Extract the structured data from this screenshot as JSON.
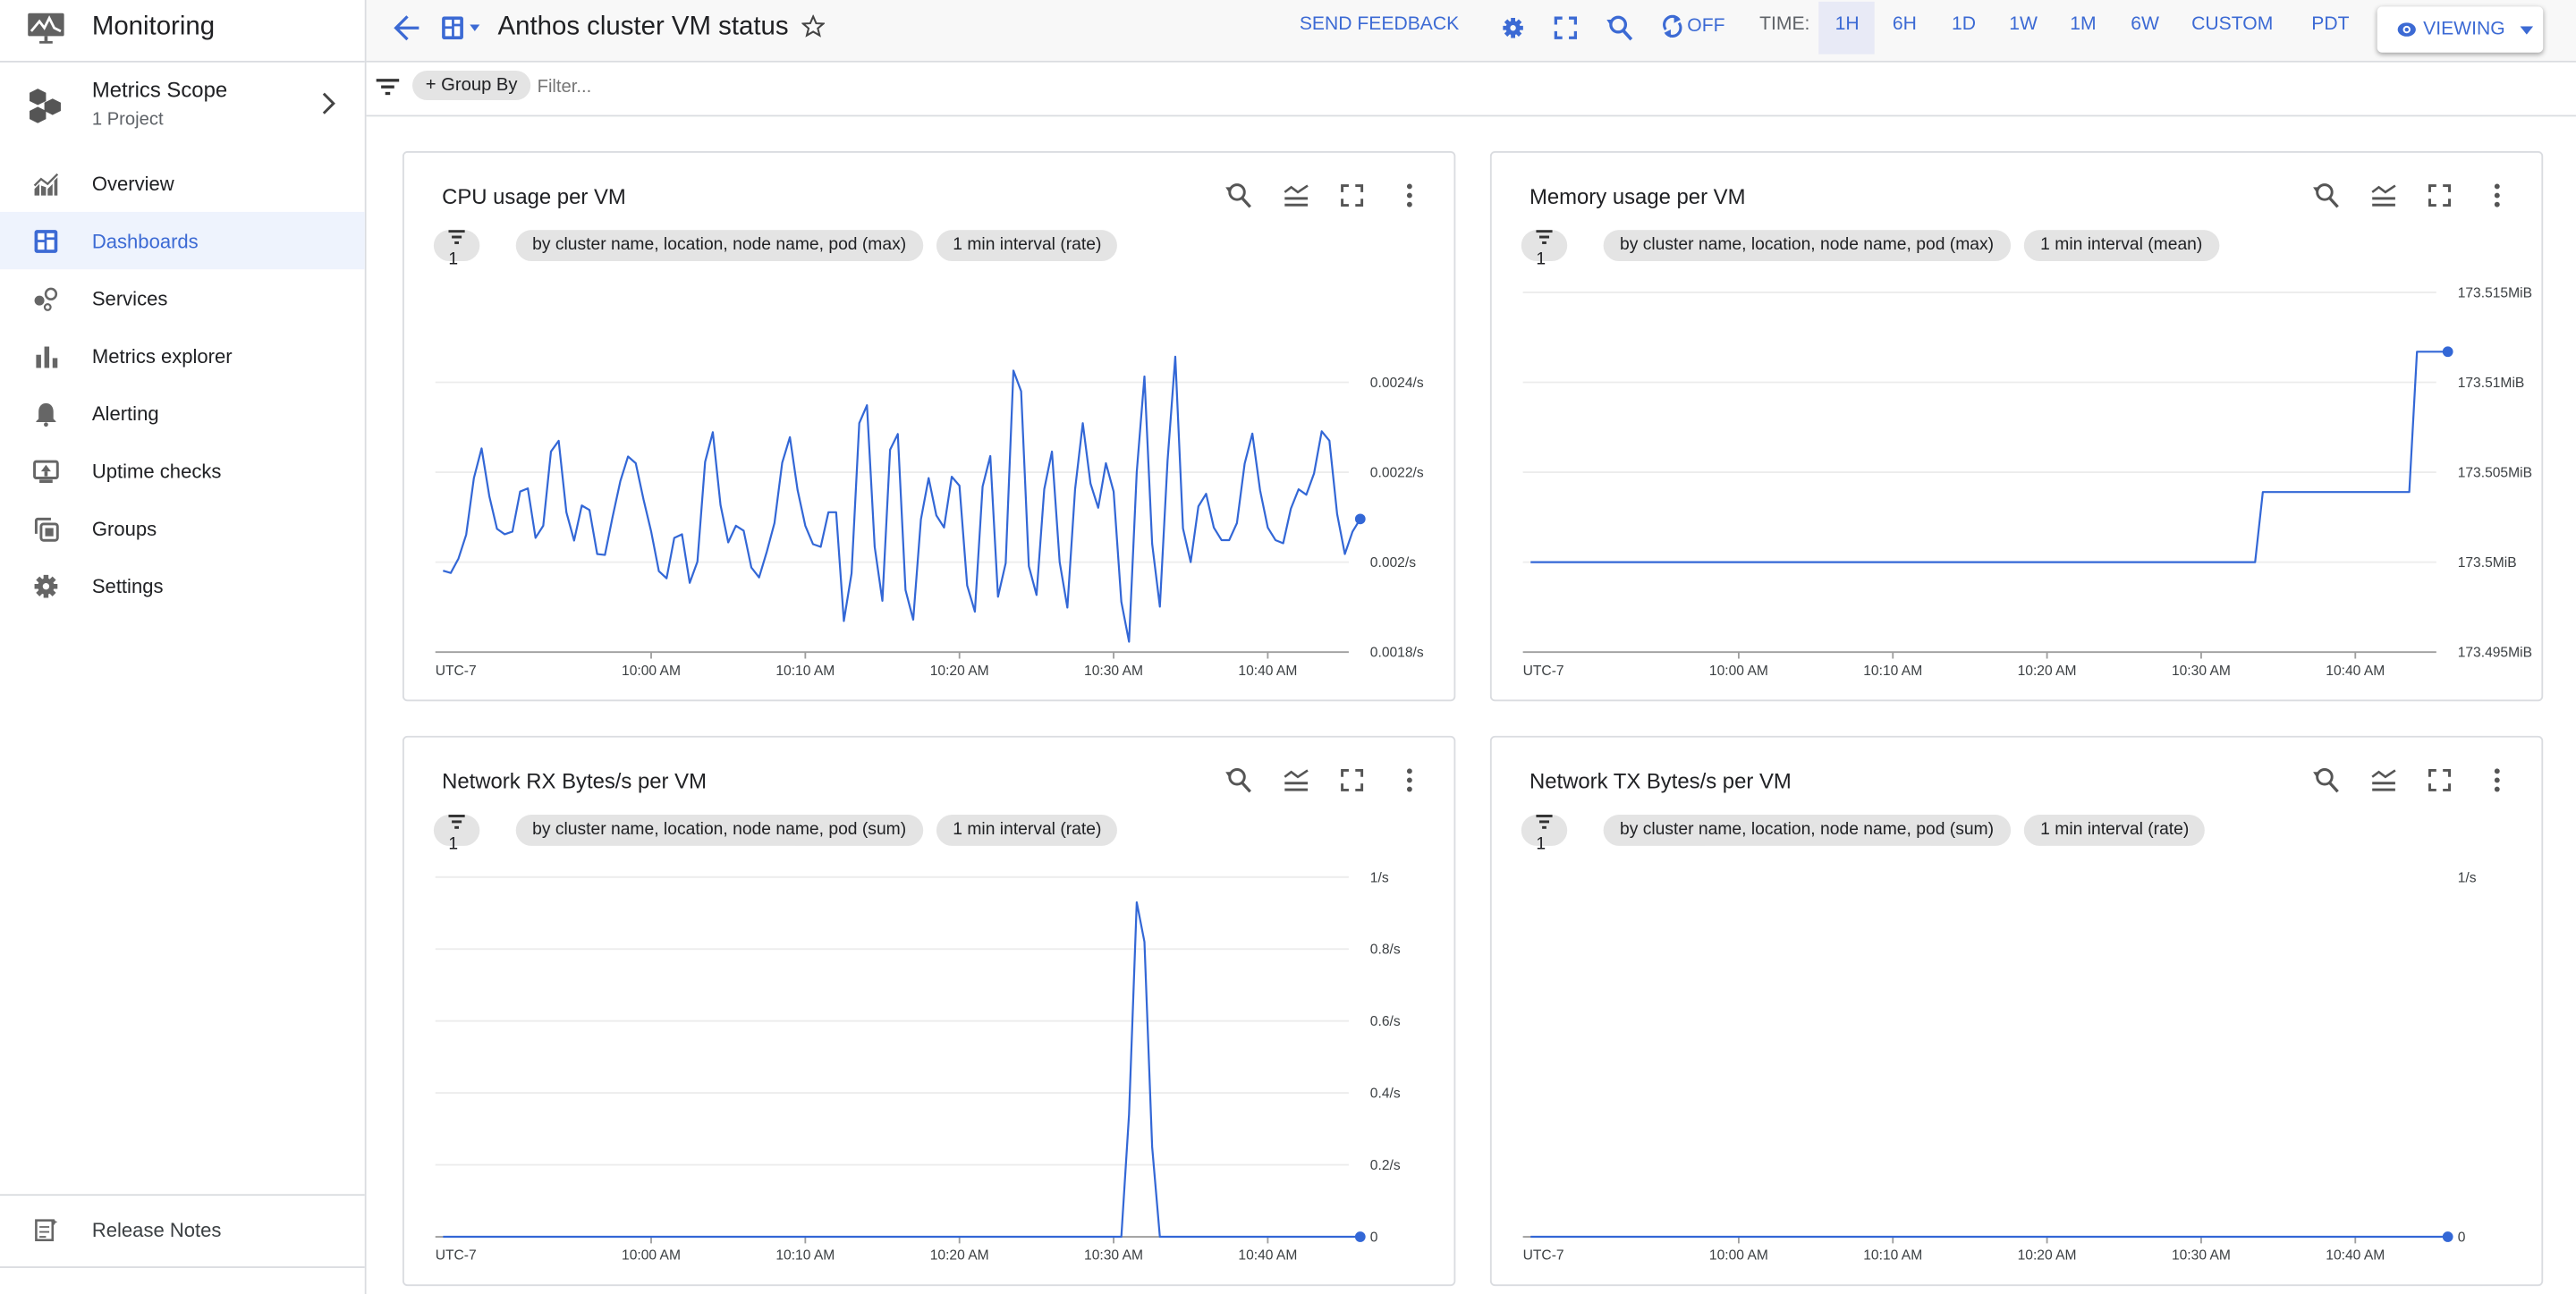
{
  "app": {
    "title": "Monitoring"
  },
  "scope": {
    "title": "Metrics Scope",
    "subtitle": "1 Project"
  },
  "sidebar": {
    "items": [
      {
        "label": "Overview",
        "icon": "overview-chart-icon"
      },
      {
        "label": "Dashboards",
        "icon": "dashboard-icon",
        "active": true
      },
      {
        "label": "Services",
        "icon": "services-icon"
      },
      {
        "label": "Metrics explorer",
        "icon": "bar-chart-icon"
      },
      {
        "label": "Alerting",
        "icon": "bell-icon"
      },
      {
        "label": "Uptime checks",
        "icon": "monitor-icon"
      },
      {
        "label": "Groups",
        "icon": "groups-icon"
      },
      {
        "label": "Settings",
        "icon": "gear-icon"
      }
    ],
    "release_notes": "Release Notes"
  },
  "header": {
    "title": "Anthos cluster VM status",
    "send_feedback": "SEND FEEDBACK",
    "refresh_state": "OFF",
    "time_label": "TIME:",
    "time_ranges": [
      "1H",
      "6H",
      "1D",
      "1W",
      "1M",
      "6W",
      "CUSTOM"
    ],
    "selected_range": "1H",
    "timezone": "PDT",
    "mode": "VIEWING"
  },
  "filterbar": {
    "group_by": "Group By",
    "filter_placeholder": "Filter..."
  },
  "colors": {
    "accent": "#3c6ad4",
    "series": "#3367d6",
    "active_bg": "#eef3fd"
  },
  "cards": [
    {
      "title": "CPU usage per VM",
      "filter_count": "1",
      "aggregation": "by cluster name, location, node name, pod (max)",
      "interval": "1 min interval (rate)"
    },
    {
      "title": "Memory usage per VM",
      "filter_count": "1",
      "aggregation": "by cluster name, location, node name, pod (max)",
      "interval": "1 min interval (mean)"
    },
    {
      "title": "Network RX Bytes/s per VM",
      "filter_count": "1",
      "aggregation": "by cluster name, location, node name, pod (sum)",
      "interval": "1 min interval (rate)"
    },
    {
      "title": "Network TX Bytes/s per VM",
      "filter_count": "1",
      "aggregation": "by cluster name, location, node name, pod (sum)",
      "interval": "1 min interval (rate)"
    }
  ],
  "chart_data": [
    {
      "type": "line",
      "xlim": [
        "9:46:00",
        "10:46:00"
      ],
      "ylim": [
        0.0018,
        0.0026
      ],
      "grid": true,
      "timezone_label": "UTC-7",
      "xticks": [
        {
          "time": "10:00:00",
          "label": "10:00 AM"
        },
        {
          "time": "10:10:00",
          "label": "10:10 AM"
        },
        {
          "time": "10:20:00",
          "label": "10:20 AM"
        },
        {
          "time": "10:30:00",
          "label": "10:30 AM"
        },
        {
          "time": "10:40:00",
          "label": "10:40 AM"
        }
      ],
      "yticks": [
        {
          "value": 0.0018,
          "label": "0.0018/s"
        },
        {
          "value": 0.002,
          "label": "0.002/s"
        },
        {
          "value": 0.0022,
          "label": "0.0022/s"
        },
        {
          "value": 0.0024,
          "label": "0.0024/s"
        }
      ],
      "x": [
        "9:46:30",
        "9:47:00",
        "9:47:30",
        "9:48:00",
        "9:48:30",
        "9:49:00",
        "9:49:30",
        "9:50:00",
        "9:50:30",
        "9:51:00",
        "9:51:30",
        "9:52:00",
        "9:52:30",
        "9:53:00",
        "9:53:30",
        "9:54:00",
        "9:54:30",
        "9:55:00",
        "9:55:30",
        "9:56:00",
        "9:56:30",
        "9:57:00",
        "9:57:30",
        "9:58:00",
        "9:58:30",
        "9:59:00",
        "9:59:30",
        "10:00:00",
        "10:00:30",
        "10:01:00",
        "10:01:30",
        "10:02:00",
        "10:02:30",
        "10:03:00",
        "10:03:30",
        "10:04:00",
        "10:04:30",
        "10:05:00",
        "10:05:30",
        "10:06:00",
        "10:06:30",
        "10:07:00",
        "10:07:30",
        "10:08:00",
        "10:08:30",
        "10:09:00",
        "10:09:30",
        "10:10:00",
        "10:10:30",
        "10:11:00",
        "10:11:30",
        "10:12:00",
        "10:12:30",
        "10:13:00",
        "10:13:30",
        "10:14:00",
        "10:14:30",
        "10:15:00",
        "10:15:30",
        "10:16:00",
        "10:16:30",
        "10:17:00",
        "10:17:30",
        "10:18:00",
        "10:18:30",
        "10:19:00",
        "10:19:30",
        "10:20:00",
        "10:20:30",
        "10:21:00",
        "10:21:30",
        "10:22:00",
        "10:22:30",
        "10:23:00",
        "10:23:30",
        "10:24:00",
        "10:24:30",
        "10:25:00",
        "10:25:30",
        "10:26:00",
        "10:26:30",
        "10:27:00",
        "10:27:30",
        "10:28:00",
        "10:28:30",
        "10:29:00",
        "10:29:30",
        "10:30:00",
        "10:30:30",
        "10:31:00",
        "10:31:30",
        "10:32:00",
        "10:32:30",
        "10:33:00",
        "10:33:30",
        "10:34:00",
        "10:34:30",
        "10:35:00",
        "10:35:30",
        "10:36:00",
        "10:36:30",
        "10:37:00",
        "10:37:30",
        "10:38:00",
        "10:38:30",
        "10:39:00",
        "10:39:30",
        "10:40:00",
        "10:40:30",
        "10:41:00",
        "10:41:30",
        "10:42:00",
        "10:42:30",
        "10:43:00",
        "10:43:30",
        "10:44:00",
        "10:44:30",
        "10:45:00",
        "10:45:30",
        "10:46:00"
      ],
      "series": [
        {
          "values": [
            0.001981,
            0.001976,
            0.002008,
            0.002061,
            0.002187,
            0.002253,
            0.002147,
            0.002074,
            0.002062,
            0.002068,
            0.002157,
            0.002164,
            0.002054,
            0.002081,
            0.002246,
            0.00227,
            0.002111,
            0.002048,
            0.002126,
            0.002116,
            0.002018,
            0.002016,
            0.002101,
            0.00218,
            0.002235,
            0.00222,
            0.00214,
            0.002068,
            0.00198,
            0.001964,
            0.002054,
            0.002062,
            0.001954,
            0.002001,
            0.002223,
            0.002289,
            0.002127,
            0.002044,
            0.002081,
            0.00207,
            0.001988,
            0.001966,
            0.002023,
            0.002087,
            0.002221,
            0.002278,
            0.00216,
            0.002081,
            0.00204,
            0.002034,
            0.002111,
            0.002111,
            0.001869,
            0.001975,
            0.002309,
            0.002349,
            0.002034,
            0.001914,
            0.00225,
            0.002285,
            0.001938,
            0.001872,
            0.002095,
            0.002187,
            0.002104,
            0.002077,
            0.00219,
            0.00217,
            0.001948,
            0.00189,
            0.002168,
            0.002236,
            0.001923,
            0.001998,
            0.002426,
            0.00238,
            0.001991,
            0.001927,
            0.002162,
            0.002246,
            0.002,
            0.001899,
            0.002162,
            0.002309,
            0.002175,
            0.002121,
            0.00222,
            0.002157,
            0.001912,
            0.001823,
            0.0022,
            0.002413,
            0.002041,
            0.001901,
            0.002226,
            0.002457,
            0.002075,
            0.002,
            0.002124,
            0.002152,
            0.002077,
            0.002049,
            0.002049,
            0.002087,
            0.002219,
            0.002286,
            0.00216,
            0.002077,
            0.002049,
            0.002042,
            0.002119,
            0.002162,
            0.00215,
            0.002197,
            0.002291,
            0.00227,
            0.002107,
            0.002018,
            0.002068,
            0.002096
          ]
        }
      ]
    },
    {
      "type": "line",
      "xlim": [
        "9:46:00",
        "10:46:00"
      ],
      "ylim": [
        173.495,
        173.515
      ],
      "grid": true,
      "timezone_label": "UTC-7",
      "xticks": [
        {
          "time": "10:00:00",
          "label": "10:00 AM"
        },
        {
          "time": "10:10:00",
          "label": "10:10 AM"
        },
        {
          "time": "10:20:00",
          "label": "10:20 AM"
        },
        {
          "time": "10:30:00",
          "label": "10:30 AM"
        },
        {
          "time": "10:40:00",
          "label": "10:40 AM"
        }
      ],
      "yticks": [
        {
          "value": 173.495,
          "label": "173.495MiB"
        },
        {
          "value": 173.5,
          "label": "173.5MiB"
        },
        {
          "value": 173.505,
          "label": "173.505MiB"
        },
        {
          "value": 173.51,
          "label": "173.51MiB"
        },
        {
          "value": 173.515,
          "label": "173.515MiB"
        }
      ],
      "x": [
        "9:46:30",
        "10:33:30",
        "10:34:00",
        "10:43:30",
        "10:44:00",
        "10:46:00"
      ],
      "series": [
        {
          "values": [
            173.5,
            173.5,
            173.5039,
            173.5039,
            173.5117,
            173.5117
          ]
        }
      ]
    },
    {
      "type": "line",
      "xlim": [
        "9:46:00",
        "10:46:00"
      ],
      "ylim": [
        0,
        1
      ],
      "grid": true,
      "timezone_label": "UTC-7",
      "xticks": [
        {
          "time": "10:00:00",
          "label": "10:00 AM"
        },
        {
          "time": "10:10:00",
          "label": "10:10 AM"
        },
        {
          "time": "10:20:00",
          "label": "10:20 AM"
        },
        {
          "time": "10:30:00",
          "label": "10:30 AM"
        },
        {
          "time": "10:40:00",
          "label": "10:40 AM"
        }
      ],
      "yticks": [
        {
          "value": 0,
          "label": "0"
        },
        {
          "value": 0.2,
          "label": "0.2/s"
        },
        {
          "value": 0.4,
          "label": "0.4/s"
        },
        {
          "value": 0.6,
          "label": "0.6/s"
        },
        {
          "value": 0.8,
          "label": "0.8/s"
        },
        {
          "value": 1,
          "label": "1/s"
        }
      ],
      "x": [
        "9:46:30",
        "10:30:30",
        "10:31:00",
        "10:31:30",
        "10:32:00",
        "10:32:30",
        "10:33:00",
        "10:46:00"
      ],
      "series": [
        {
          "values": [
            0,
            0,
            0.34,
            0.93,
            0.82,
            0.25,
            0,
            0
          ]
        }
      ]
    },
    {
      "type": "line",
      "xlim": [
        "9:46:00",
        "10:46:00"
      ],
      "ylim": [
        0,
        1
      ],
      "grid": false,
      "timezone_label": "UTC-7",
      "xticks": [
        {
          "time": "10:00:00",
          "label": "10:00 AM"
        },
        {
          "time": "10:10:00",
          "label": "10:10 AM"
        },
        {
          "time": "10:20:00",
          "label": "10:20 AM"
        },
        {
          "time": "10:30:00",
          "label": "10:30 AM"
        },
        {
          "time": "10:40:00",
          "label": "10:40 AM"
        }
      ],
      "yticks": [
        {
          "value": 0,
          "label": "0"
        },
        {
          "value": 1,
          "label": "1/s"
        }
      ],
      "x": [
        "9:46:30",
        "10:46:00"
      ],
      "series": [
        {
          "values": [
            0,
            0
          ]
        }
      ]
    }
  ]
}
